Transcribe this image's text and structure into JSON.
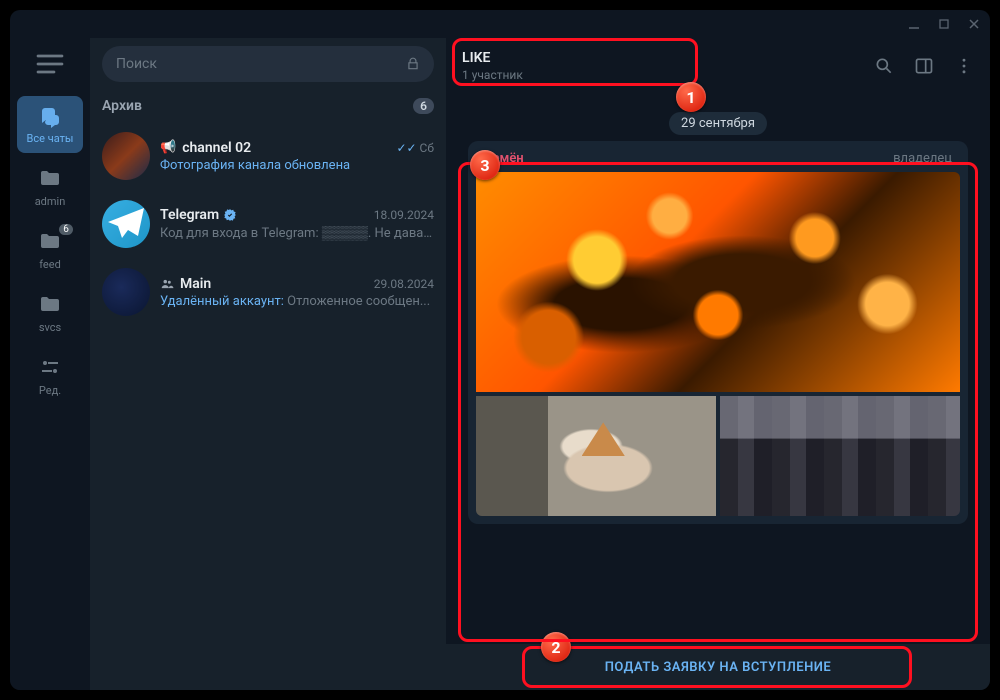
{
  "search": {
    "placeholder": "Поиск"
  },
  "rail": {
    "items": [
      {
        "label": "Все чаты",
        "icon": "chat",
        "active": true
      },
      {
        "label": "admin",
        "icon": "folder"
      },
      {
        "label": "feed",
        "icon": "folder",
        "badge": "6"
      },
      {
        "label": "svcs",
        "icon": "folder"
      },
      {
        "label": "Ред.",
        "icon": "sliders"
      }
    ]
  },
  "archive": {
    "label": "Архив",
    "count": "6"
  },
  "chats": [
    {
      "name": "channel 02",
      "time": "Сб",
      "read": true,
      "kind": "channel",
      "preview_hl": "Фотография канала обновлена",
      "preview_rest": ""
    },
    {
      "name": "Telegram",
      "verified": true,
      "time": "18.09.2024",
      "kind": "plain",
      "preview_hl": "",
      "preview_rest": "Код для входа в Telegram: ▒▒▒▒▒. Не давайт..."
    },
    {
      "name": "Main",
      "time": "29.08.2024",
      "kind": "group",
      "preview_hl": "Удалённый аккаунт: ",
      "preview_rest": "Отложенное сообщен..."
    }
  ],
  "header": {
    "title": "LIKE",
    "subtitle": "1 участник"
  },
  "feed": {
    "date": "29 сентября",
    "author": "Семён",
    "role": "владелец"
  },
  "join_button": "ПОДАТЬ ЗАЯВКУ НА ВСТУПЛЕНИЕ",
  "annotations": {
    "a1": "1",
    "a2": "2",
    "a3": "3"
  }
}
